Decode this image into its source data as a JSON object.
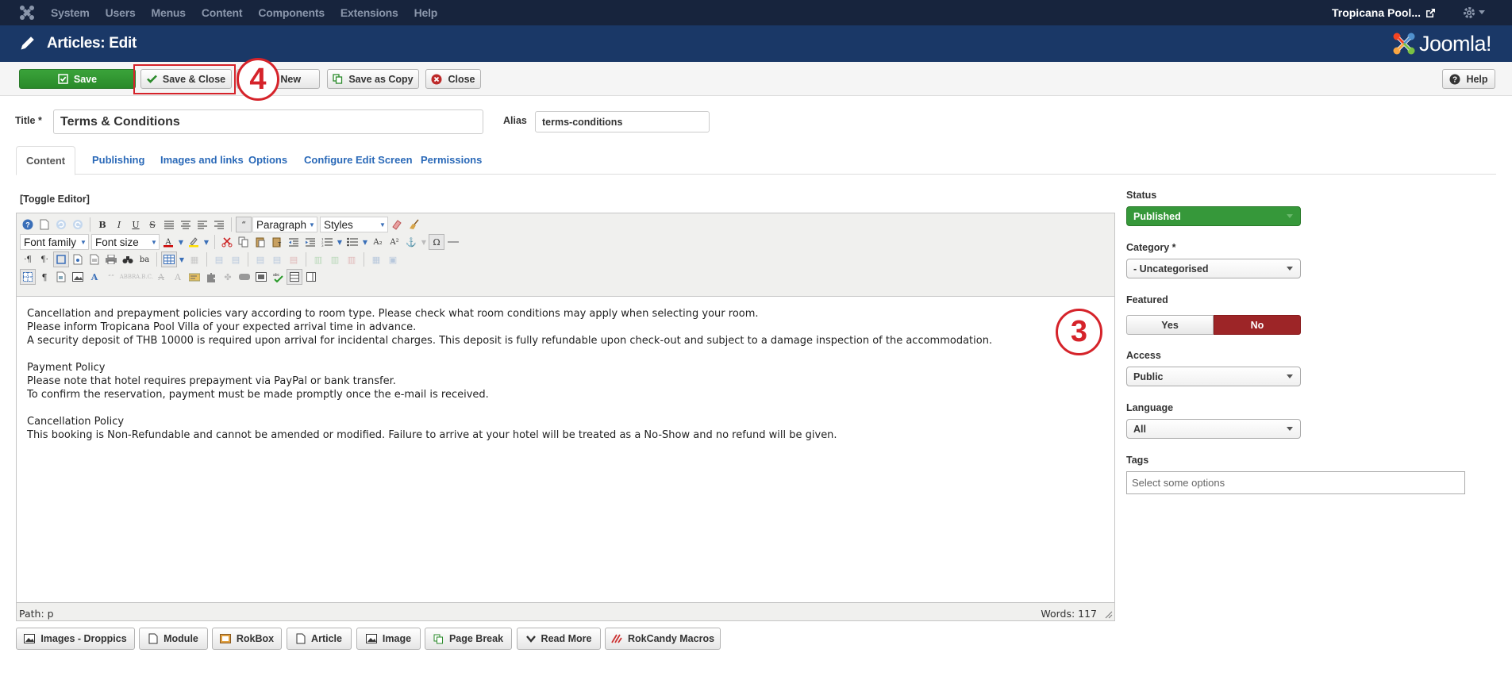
{
  "topbar": {
    "menu": [
      "System",
      "Users",
      "Menus",
      "Content",
      "Components",
      "Extensions",
      "Help"
    ],
    "site_name": "Tropicana Pool..."
  },
  "header": {
    "title": "Articles: Edit",
    "logo_text": "Joomla!"
  },
  "toolbar": {
    "save": "Save",
    "save_close": "Save & Close",
    "save_new": "& New",
    "save_copy": "Save as Copy",
    "close": "Close",
    "help": "Help"
  },
  "callouts": {
    "step4": "4",
    "step3": "3"
  },
  "form": {
    "title_label": "Title *",
    "title_value": "Terms & Conditions",
    "alias_label": "Alias",
    "alias_value": "terms-conditions"
  },
  "tabs": [
    "Content",
    "Publishing",
    "Images and links",
    "Options",
    "Configure Edit Screen",
    "Permissions"
  ],
  "editor": {
    "toggle_label": "[Toggle Editor]",
    "format_select": "Paragraph",
    "styles_select": "Styles",
    "font_family_select": "Font family",
    "font_size_select": "Font size",
    "content_lines": [
      "Cancellation and prepayment policies vary according to room type. Please check what room conditions may apply when selecting your room.",
      "Please inform Tropicana Pool Villa of your expected arrival time in advance.",
      "A security deposit of THB 10000 is required upon arrival for incidental charges. This deposit is fully refundable upon check-out and subject to a damage inspection of the accommodation.",
      "",
      "Payment Policy",
      "Please note that hotel requires prepayment via PayPal or bank transfer.",
      "To confirm the reservation, payment must be made promptly once the e-mail is received.",
      "",
      "Cancellation Policy",
      "This booking is Non-Refundable and cannot be amended or modified. Failure to arrive at your hotel will be treated as a No-Show and no refund will be given."
    ],
    "path": "Path: p",
    "words": "Words: 117"
  },
  "editor_buttons": [
    "Images - Droppics",
    "Module",
    "RokBox",
    "Article",
    "Image",
    "Page Break",
    "Read More",
    "RokCandy Macros"
  ],
  "sidebar": {
    "status_label": "Status",
    "status_value": "Published",
    "category_label": "Category *",
    "category_value": "- Uncategorised",
    "featured_label": "Featured",
    "featured_yes": "Yes",
    "featured_no": "No",
    "access_label": "Access",
    "access_value": "Public",
    "language_label": "Language",
    "language_value": "All",
    "tags_label": "Tags",
    "tags_placeholder": "Select some options"
  },
  "colors": {
    "topbar": "#17243d",
    "header": "#1a3867",
    "save_green": "#2f952f",
    "featured_no_red": "#9d2527",
    "callout_red": "#d5232a",
    "link_blue": "#2a69b8"
  }
}
